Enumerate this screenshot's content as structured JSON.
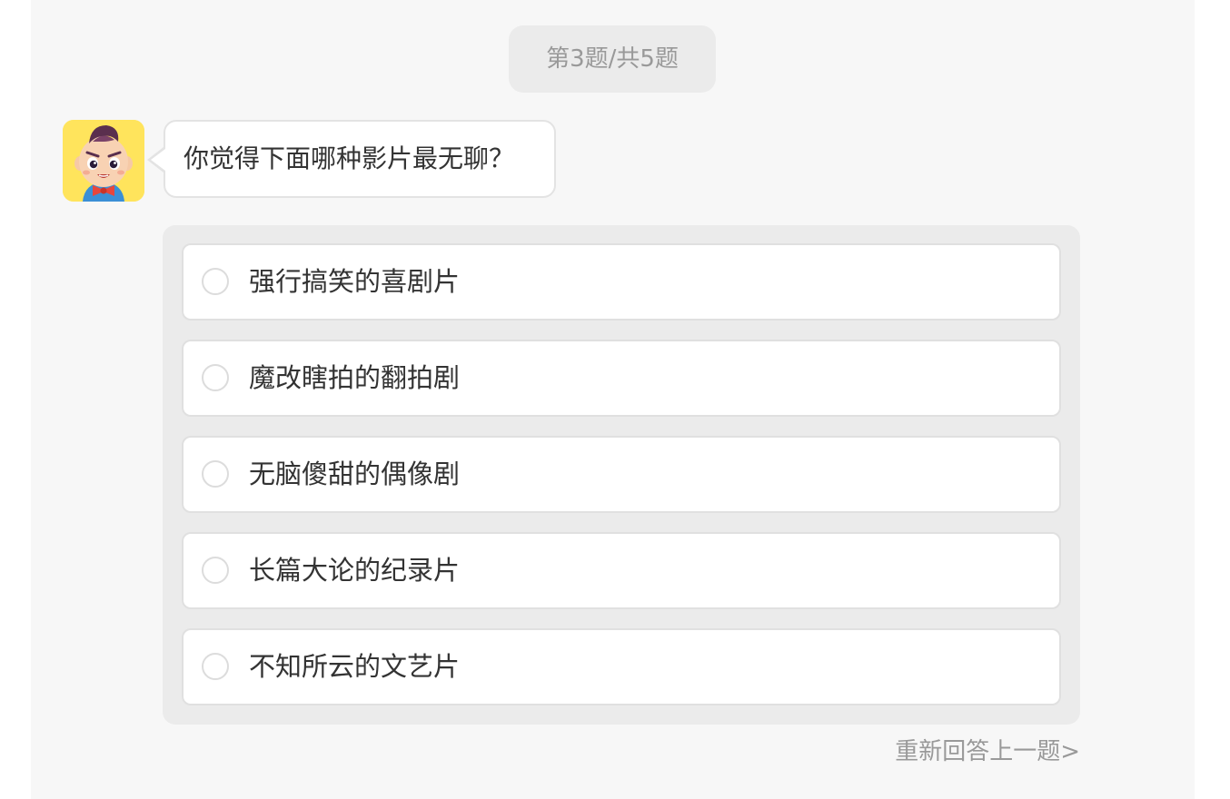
{
  "progress": {
    "text": "第3题/共5题"
  },
  "question": {
    "avatar_icon": "cartoon-boy-avatar-icon",
    "text": "你觉得下面哪种影片最无聊？"
  },
  "options": [
    {
      "label": "强行搞笑的喜剧片"
    },
    {
      "label": "魔改瞎拍的翻拍剧"
    },
    {
      "label": "无脑傻甜的偶像剧"
    },
    {
      "label": "长篇大论的纪录片"
    },
    {
      "label": "不知所云的文艺片"
    }
  ],
  "redo_link": "重新回答上一题>",
  "colors": {
    "panel_bg": "#f7f7f7",
    "pill_bg": "#ebebeb",
    "muted_text": "#999999",
    "primary_text": "#333333",
    "avatar_bg": "#ffe45c"
  }
}
